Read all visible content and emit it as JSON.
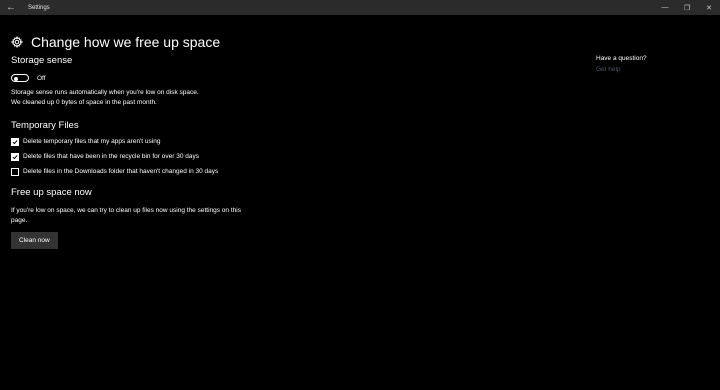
{
  "titlebar": {
    "title": "Settings",
    "back_glyph": "←",
    "minimize_glyph": "—",
    "maximize_glyph": "❐",
    "close_glyph": "✕"
  },
  "header": {
    "icon": "gear-icon",
    "title": "Change how we free up space"
  },
  "storage_sense": {
    "heading": "Storage sense",
    "toggle_state": "Off",
    "description_line1": "Storage sense runs automatically when you're low on disk space.",
    "description_line2": "We cleaned up 0 bytes of space in the past month."
  },
  "temporary_files": {
    "heading": "Temporary Files",
    "options": [
      {
        "label": "Delete temporary files that my apps aren't using",
        "checked": true
      },
      {
        "label": "Delete files that have been in the recycle bin for over 30 days",
        "checked": true
      },
      {
        "label": "Delete files in the Downloads folder that haven't changed in 30 days",
        "checked": false
      }
    ]
  },
  "free_up_space": {
    "heading": "Free up space now",
    "description": "If you're low on space, we can try to clean up files now using the settings on this page.",
    "button_label": "Clean now"
  },
  "aside": {
    "question": "Have a question?",
    "link": "Get help"
  },
  "colors": {
    "background": "#000000",
    "titlebar": "#2b2b2b",
    "link": "#4a5866",
    "button": "#333333"
  }
}
